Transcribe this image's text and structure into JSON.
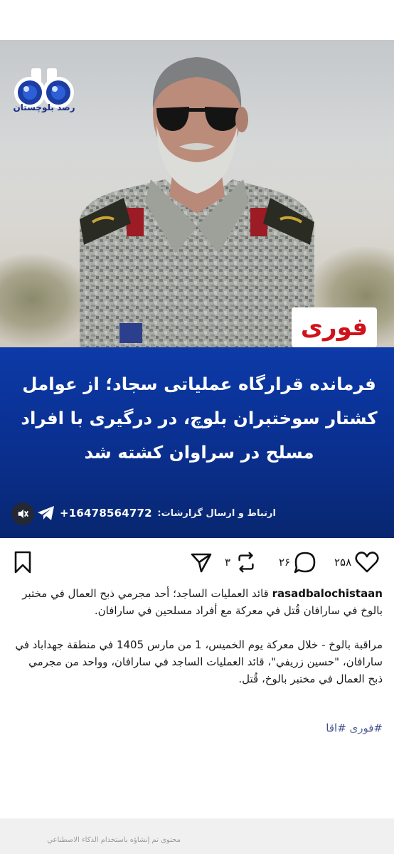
{
  "post": {
    "logo_text": "رصد بلوچستان",
    "badge_text": "فوری",
    "headline": "فرمانده قرارگاه عملیاتی سجاد؛ از عوامل کشتار سوختبران بلوچ، در درگیری با افراد مسلح در سراوان کشته شد",
    "contact_label": "ارتباط و ارسال گزارشات:",
    "phone": "+16478564772"
  },
  "actions": {
    "like_count": "۲۵۸",
    "comment_count": "۲۶",
    "repost_count": "۳"
  },
  "caption": {
    "username": "rasadbalochistaan",
    "paragraph1": "قائد العمليات الساجد؛ أحد مجرمي ذبح العمال في مختبر بالوخ في سارافان قُتل في معركة مع أفراد مسلحين في سارافان.",
    "paragraph2": "مراقبة بالوخ - خلال معركة يوم الخميس، 1 من مارس 1405 في منطقة جهداباد في سارافان، \"حسين زريفي\"، قائد العمليات الساجد في سارافان، وواحد من مجرمي ذبح العمال في مختبر بالوخ، قُتل.",
    "hashtags": "#فوری #اقا"
  },
  "footer": {
    "ai_note": "محتوى تم إنشاؤه باستخدام الذكاء الاصطناعي"
  },
  "colors": {
    "headline_panel": "#0a2f8e",
    "badge_red": "#d0121b",
    "logo_blue": "#1a2d8a"
  },
  "icons": [
    "binoculars-logo-icon",
    "mute-icon",
    "telegram-icon",
    "heart-icon",
    "comment-icon",
    "repost-icon",
    "share-icon",
    "bookmark-icon"
  ]
}
